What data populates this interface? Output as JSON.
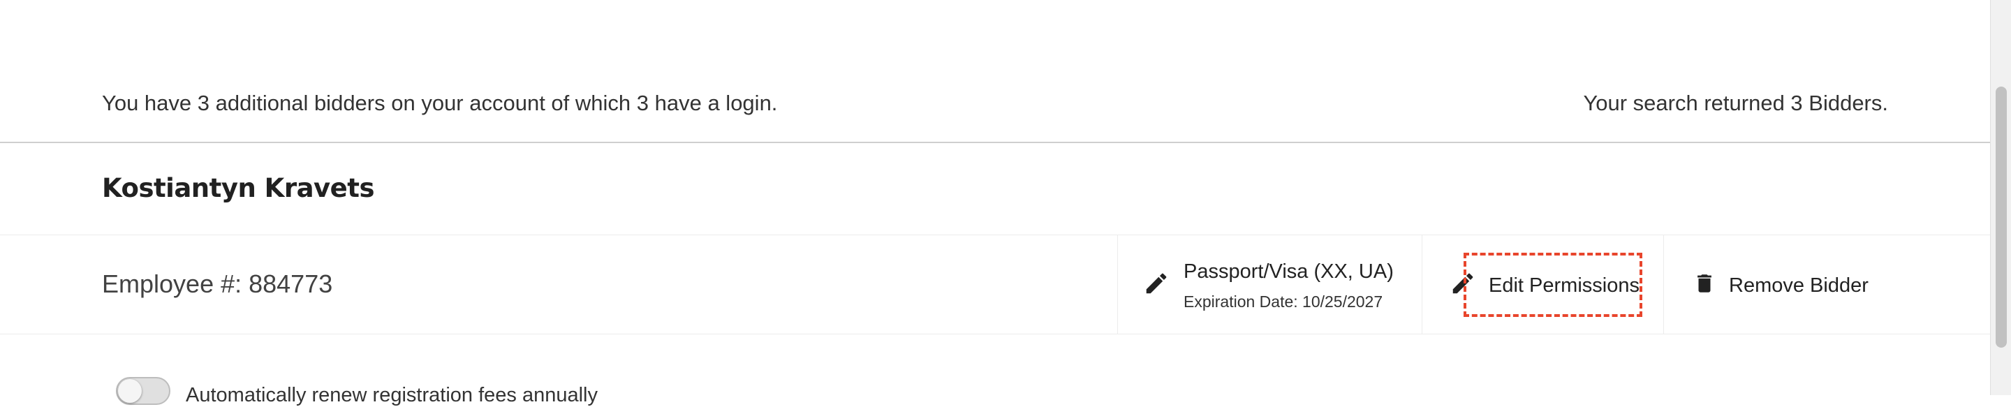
{
  "account": {
    "summary": "You have 3 additional bidders on your account of which 3 have a login.",
    "results": "Your search returned 3 Bidders."
  },
  "bidder": {
    "name": "Kostiantyn Kravets",
    "employee_id": "Employee #: 884773",
    "document": {
      "title": "Passport/Visa (XX, UA)",
      "expiration": "Expiration Date: 10/25/2027",
      "icon": "pencil-icon"
    },
    "actions": {
      "edit_permissions": "Edit Permissions",
      "edit_icon": "pencil-icon",
      "remove_bidder": "Remove Bidder",
      "remove_icon": "trash-icon"
    }
  },
  "auto_renew": {
    "label": "Automatically renew registration fees annually",
    "enabled": false
  },
  "colors": {
    "focus_outline": "#e8452c",
    "text": "#333333",
    "divider": "#cfcfcf"
  }
}
